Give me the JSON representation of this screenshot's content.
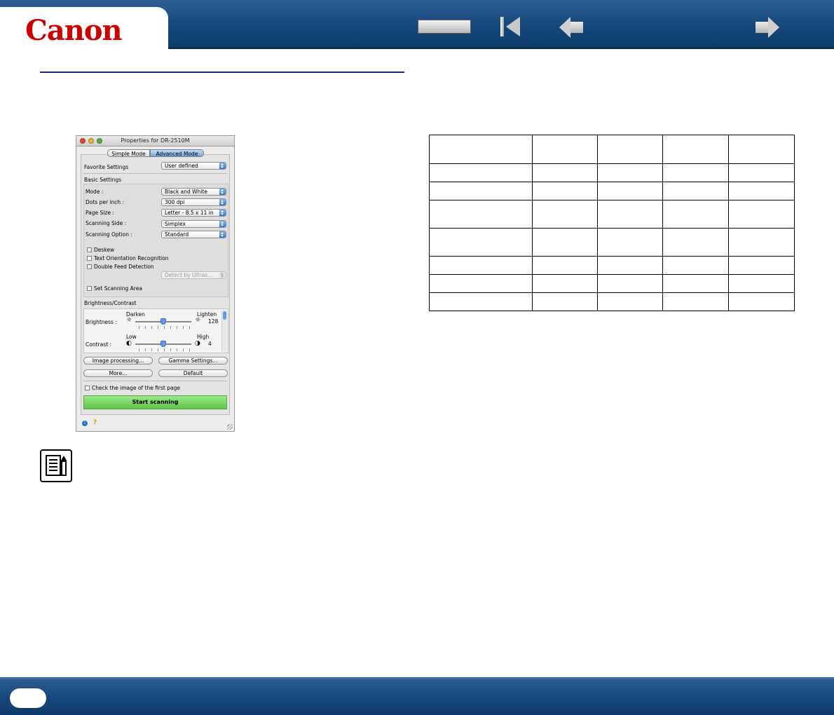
{
  "header": {
    "logo": "Canon",
    "nav": [
      "blank-button",
      "first-page-icon",
      "previous-page-icon",
      "next-page-icon"
    ]
  },
  "dialog": {
    "title": "Properties for DR-2510M",
    "modes": {
      "simple": "Simple Mode",
      "advanced": "Advanced Mode",
      "selected": "Advanced Mode"
    },
    "favorite": {
      "label": "Favorite Settings",
      "value": "User defined"
    },
    "basic_settings": {
      "heading": "Basic Settings",
      "fields": [
        {
          "label": "Mode :",
          "value": "Black and White"
        },
        {
          "label": "Dots per inch :",
          "value": "300 dpi"
        },
        {
          "label": "Page Size :",
          "value": "Letter - 8.5 x 11 in"
        },
        {
          "label": "Scanning Side :",
          "value": "Simplex"
        },
        {
          "label": "Scanning Option :",
          "value": "Standard"
        }
      ],
      "checkboxes": [
        {
          "label": "Deskew",
          "checked": false
        },
        {
          "label": "Text Orientation Recognition",
          "checked": false
        },
        {
          "label": "Double Feed Detection",
          "checked": false
        }
      ],
      "detect_popup": "Detect by Ultras...",
      "scan_area": {
        "label": "Set Scanning Area",
        "checked": false
      }
    },
    "brightness_contrast": {
      "heading": "Brightness/Contrast",
      "brightness": {
        "label": "Brightness :",
        "low": "Darken",
        "high": "Lighten",
        "value": "128",
        "level": 0.5
      },
      "contrast": {
        "label": "Contrast :",
        "low": "Low",
        "high": "High",
        "value": "4",
        "level": 0.5
      }
    },
    "buttons": {
      "image_processing": "Image processing...",
      "gamma": "Gamma Settings...",
      "more": "More...",
      "default": "Default"
    },
    "first_page_check": {
      "label": "Check the image of the first page",
      "checked": false
    },
    "start": "Start scanning"
  },
  "table": {
    "rows": 8,
    "cols": 5
  },
  "colors": {
    "header_blue": "#174a7e",
    "logo_red": "#cc0000",
    "start_green": "#5cc64a",
    "rule_blue": "#0b2b83"
  }
}
